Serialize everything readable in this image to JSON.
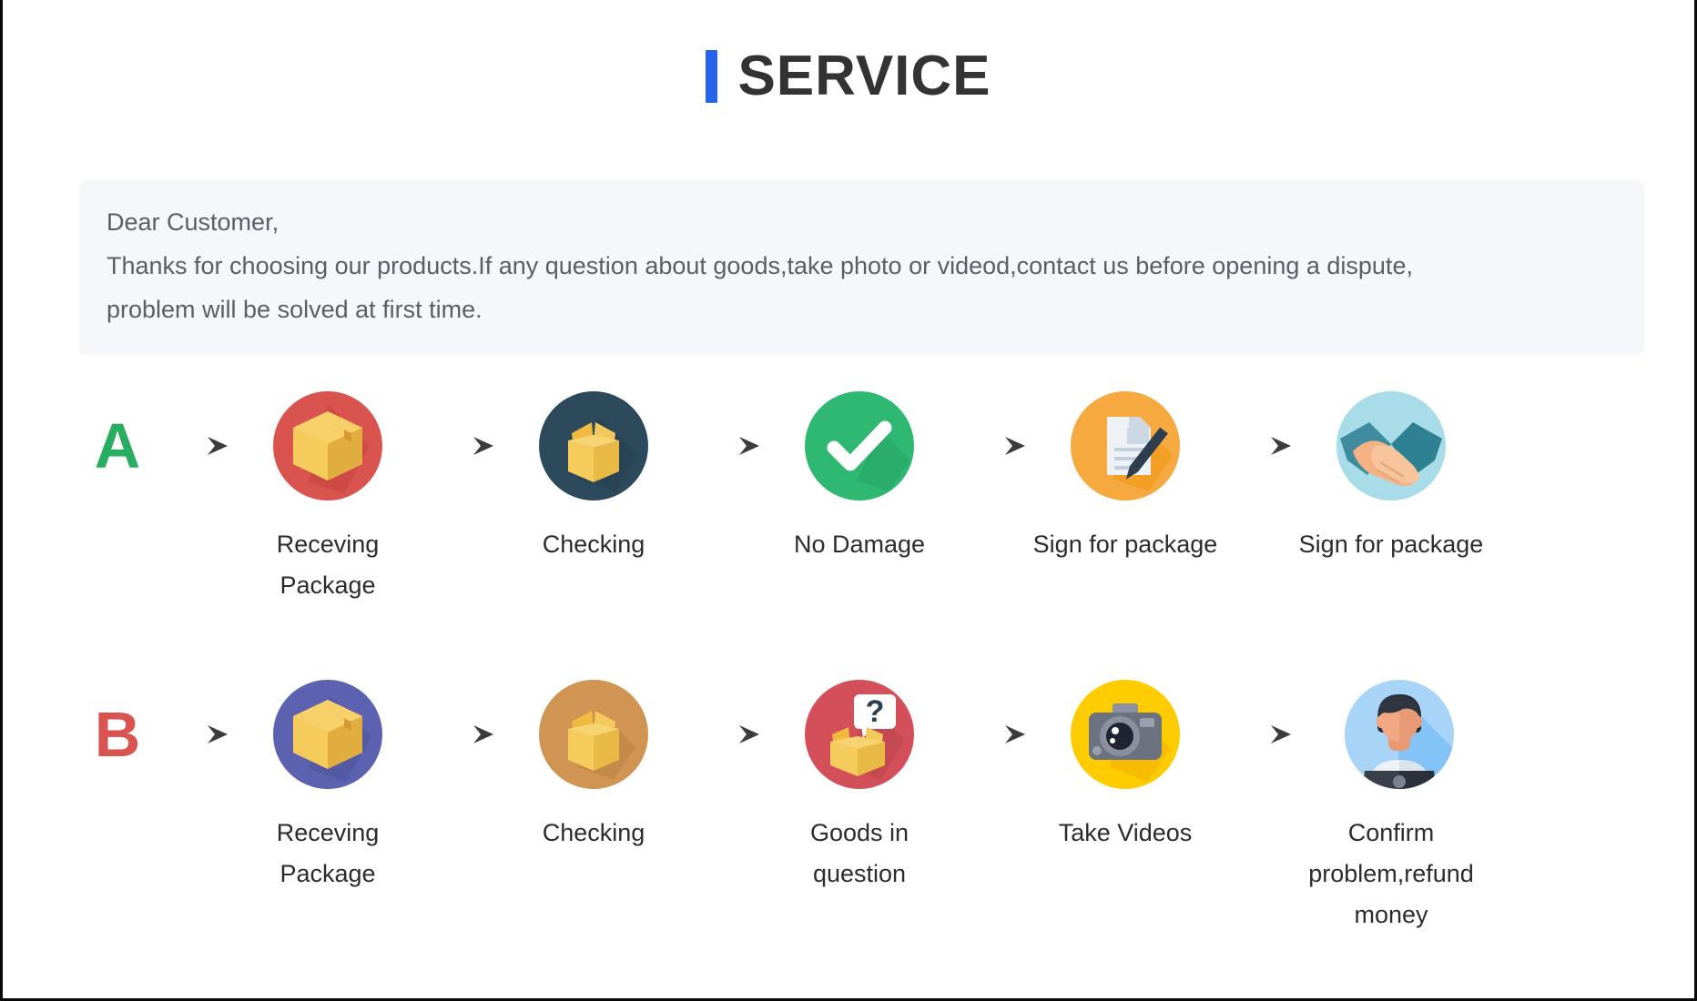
{
  "header": {
    "accent_color": "#2563eb",
    "title": "SERVICE"
  },
  "notice": {
    "background_color": "#f5f7fa",
    "lines": [
      "Dear Customer,",
      "Thanks for choosing our products.If any question about goods,take photo or videod,contact us before opening a dispute,",
      "problem will be solved at first time."
    ]
  },
  "flows": [
    {
      "letter": "A",
      "letter_color": "#27ae60",
      "steps": [
        {
          "label": "Receving Package",
          "icon": "closed-box-icon",
          "circle_color": "#d9534f"
        },
        {
          "label": "Checking",
          "icon": "open-box-icon",
          "circle_color": "#2d4a5c"
        },
        {
          "label": "No Damage",
          "icon": "checkmark-icon",
          "circle_color": "#2eb872"
        },
        {
          "label": "Sign for package",
          "icon": "document-pen-icon",
          "circle_color": "#f5a93f"
        },
        {
          "label": "Sign for package",
          "icon": "handshake-icon",
          "circle_color": "#a8dce8"
        }
      ]
    },
    {
      "letter": "B",
      "letter_color": "#d9534f",
      "steps": [
        {
          "label": "Receving Package",
          "icon": "closed-box-icon",
          "circle_color": "#5d62b0"
        },
        {
          "label": "Checking",
          "icon": "open-box-icon",
          "circle_color": "#d09552"
        },
        {
          "label": "Goods in question",
          "icon": "question-box-icon",
          "circle_color": "#d3505a"
        },
        {
          "label": "Take Videos",
          "icon": "camera-icon",
          "circle_color": "#ffcc00"
        },
        {
          "label": "Confirm problem,refund money",
          "icon": "support-person-icon",
          "circle_color": "#a8d5f7"
        }
      ]
    }
  ],
  "arrow": {
    "name": "right-arrow-icon",
    "color": "#4a4a4a"
  }
}
